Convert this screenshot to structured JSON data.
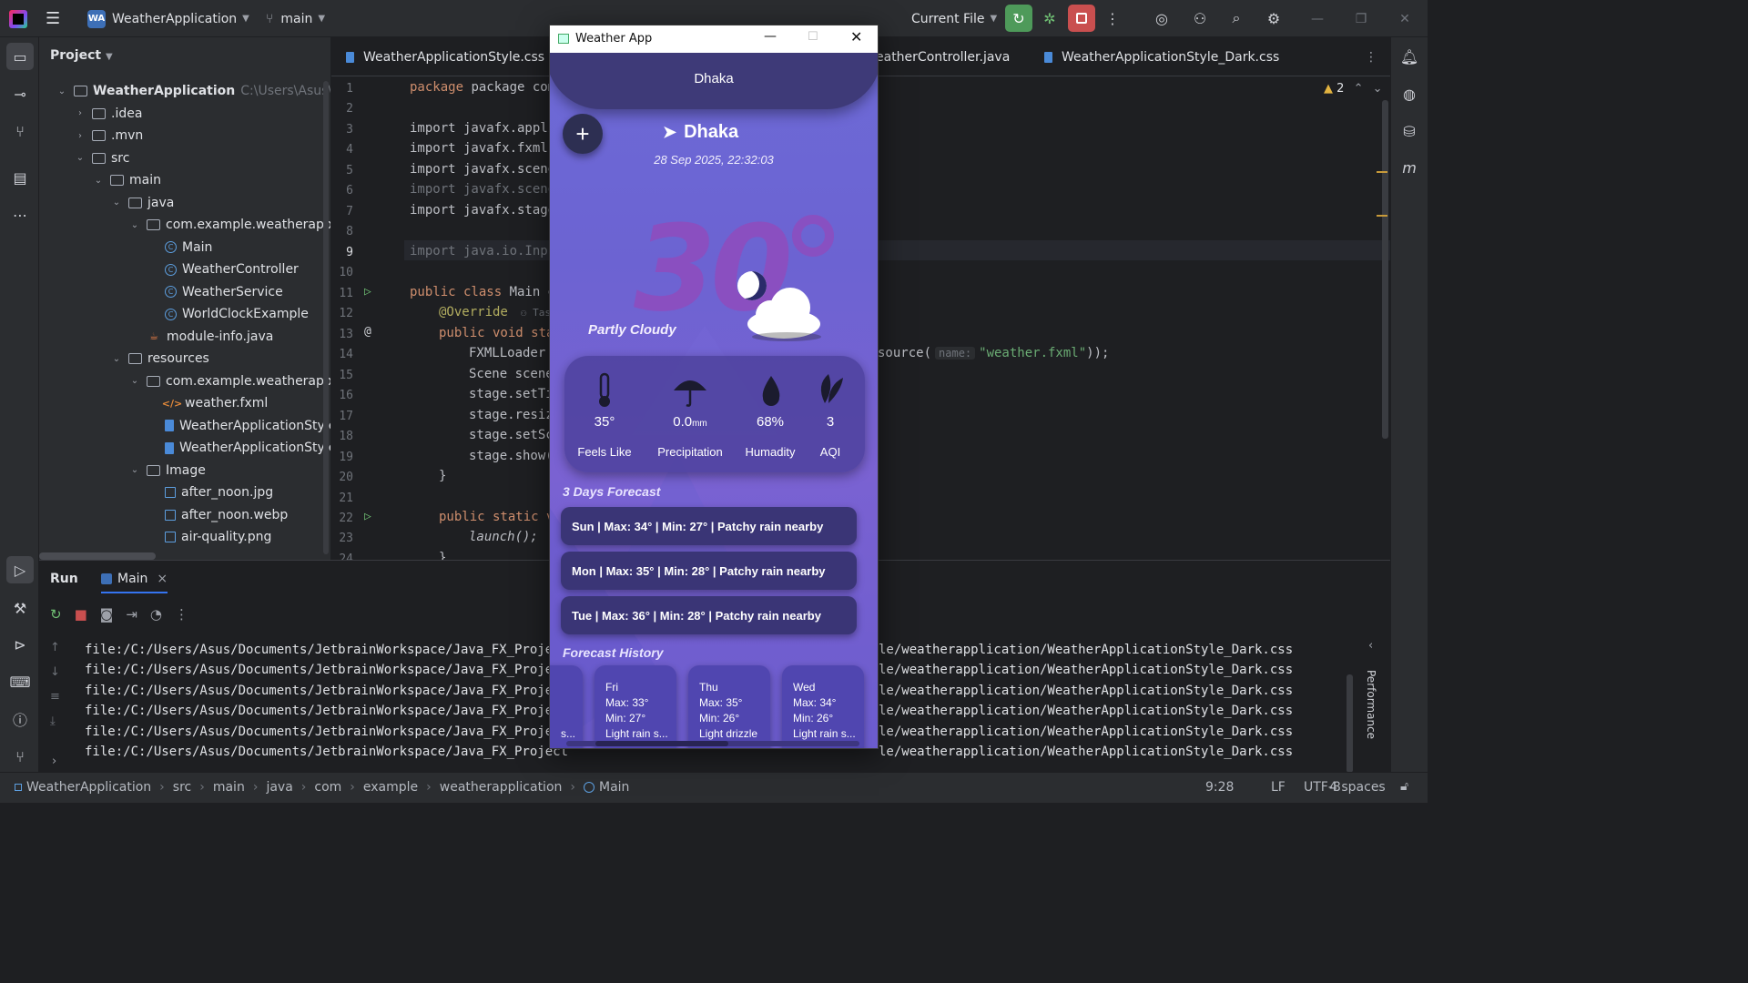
{
  "ide": {
    "project_badge": "WA",
    "project_name": "WeatherApplication",
    "branch": "main",
    "run_config": "Current File",
    "project_panel_title": "Project",
    "tree": [
      {
        "label": "WeatherApplication",
        "hint": "C:\\Users\\Asus\\Doc",
        "icon": "folder",
        "bold": true
      },
      {
        "label": ".idea",
        "icon": "folder"
      },
      {
        "label": ".mvn",
        "icon": "folder"
      },
      {
        "label": "src",
        "icon": "folder"
      },
      {
        "label": "main",
        "icon": "folder"
      },
      {
        "label": "java",
        "icon": "folder"
      },
      {
        "label": "com.example.weatherapplicati",
        "icon": "package"
      },
      {
        "label": "Main",
        "icon": "class"
      },
      {
        "label": "WeatherController",
        "icon": "class"
      },
      {
        "label": "WeatherService",
        "icon": "class"
      },
      {
        "label": "WorldClockExample",
        "icon": "class"
      },
      {
        "label": "module-info.java",
        "icon": "java"
      },
      {
        "label": "resources",
        "icon": "folder"
      },
      {
        "label": "com.example.weatherapplicati",
        "icon": "package"
      },
      {
        "label": "weather.fxml",
        "icon": "xml"
      },
      {
        "label": "WeatherApplicationStyle.cs",
        "icon": "css"
      },
      {
        "label": "WeatherApplicationStyle_Da",
        "icon": "css"
      },
      {
        "label": "Image",
        "icon": "folder"
      },
      {
        "label": "after_noon.jpg",
        "icon": "image"
      },
      {
        "label": "after_noon.webp",
        "icon": "image"
      },
      {
        "label": "air-quality.png",
        "icon": "image"
      }
    ],
    "tabs": [
      "WeatherApplicationStyle.css",
      "eatherController.java",
      "WeatherApplicationStyle_Dark.css"
    ],
    "warning_count": "2",
    "line_numbers": [
      "1",
      "2",
      "3",
      "4",
      "5",
      "6",
      "7",
      "8",
      "9",
      "10",
      "11",
      "12",
      "13",
      "14",
      "15",
      "16",
      "17",
      "18",
      "19",
      "20",
      "21",
      "22",
      "23",
      "24"
    ],
    "code": {
      "l1": "package com.example",
      "l3": "import javafx.appli",
      "l4": "import javafx.fxml.",
      "l5": "import javafx.scene",
      "l6": "import javafx.scene",
      "l7": "import javafx.stage",
      "l9": "import java.io.Inpu",
      "l11a": "public class ",
      "l11b": "Main e",
      "l12": "@Override",
      "l12hint": "Tas",
      "l13": "public void sta",
      "l14": "FXMLLoader",
      "l14right_a": "source(",
      "l14right_hint": "name:",
      "l14right_str": "\"weather.fxml\"",
      "l14right_end": "));",
      "l15": "Scene scene",
      "l16": "stage.setTi",
      "l17": "stage.resiz",
      "l18": "stage.setSc",
      "l19": "stage.show(",
      "l20": "}",
      "l22": "public static v",
      "l23": "launch();",
      "l24": "}"
    },
    "run": {
      "tab_run": "Run",
      "tab_main": "Main",
      "output_left": "file:/C:/Users/Asus/Documents/JetbrainWorkspace/Java_FX_Project",
      "output_right": "le/weatherapplication/WeatherApplicationStyle_Dark.css",
      "line_count_label": "Performance"
    },
    "status": {
      "breadcrumb": [
        "WeatherApplication",
        "src",
        "main",
        "java",
        "com",
        "example",
        "weatherapplication",
        "Main"
      ],
      "position": "9:28",
      "line_sep": "LF",
      "encoding": "UTF-8",
      "indent": "4 spaces"
    }
  },
  "weather_app": {
    "window_title": "Weather App",
    "header_city": "Dhaka",
    "add_button": "+",
    "city": "Dhaka",
    "datetime": "28 Sep 2025, 22:32:03",
    "temperature": "30",
    "degree": "°",
    "condition": "Partly Cloudy",
    "stats": [
      {
        "value": "35°",
        "label": "Feels Like",
        "icon": "thermometer-icon"
      },
      {
        "value": "0.0",
        "unit": "mm",
        "label": "Precipitation",
        "icon": "umbrella-icon"
      },
      {
        "value": "68%",
        "label": "Humadity",
        "icon": "droplet-icon"
      },
      {
        "value": "3",
        "label": "AQI",
        "icon": "leaf-icon"
      }
    ],
    "forecast_title": "3 Days Forecast",
    "forecast": [
      "Sun | Max: 34° | Min: 27° | Patchy rain nearby",
      "Mon | Max: 35° | Min: 28° | Patchy rain nearby",
      "Tue | Max: 36° | Min: 28° | Patchy rain nearby"
    ],
    "history_title": "Forecast History",
    "history": [
      {
        "day": "Fri",
        "max": "Max: 33°",
        "min": "Min: 27°",
        "desc": "Light rain s..."
      },
      {
        "day": "Thu",
        "max": "Max: 35°",
        "min": "Min: 26°",
        "desc": "Light drizzle"
      },
      {
        "day": "Wed",
        "max": "Max: 34°",
        "min": "Min: 26°",
        "desc": "Light rain s..."
      }
    ],
    "history_partial": "s..."
  },
  "colors": {
    "ide_bg": "#1e1f22",
    "panel_bg": "#2b2d30",
    "run_green": "#4e9a5a",
    "stop_red": "#c94f4f",
    "weather_purple": "#6c63d2",
    "temp_purple": "#8a4fc0"
  }
}
